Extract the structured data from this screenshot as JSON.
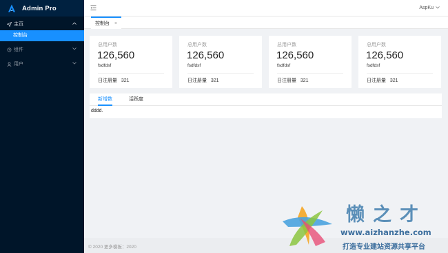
{
  "app": {
    "title": "Admin Pro"
  },
  "sidebar": {
    "groups": [
      {
        "label": "主页",
        "icon": "send-icon",
        "expanded": true,
        "items": [
          {
            "label": "控制台",
            "active": true
          }
        ]
      },
      {
        "label": "组件",
        "icon": "settings-icon",
        "expanded": false
      },
      {
        "label": "用户",
        "icon": "user-icon",
        "expanded": false
      }
    ]
  },
  "header": {
    "user": "AspKu"
  },
  "tabs": [
    {
      "label": "控制台",
      "close": "×"
    }
  ],
  "cards": [
    {
      "title": "总用户数",
      "value": "126,560",
      "sub": "fsdfdsf",
      "foot": "日注册量   321"
    },
    {
      "title": "总用户数",
      "value": "126,560",
      "sub": "fsdfdsf",
      "foot": "日注册量   321"
    },
    {
      "title": "总用户数",
      "value": "126,560",
      "sub": "fsdfdsf",
      "foot": "日注册量   321"
    },
    {
      "title": "总用户数",
      "value": "126,560",
      "sub": "fsdfdsf",
      "foot": "日注册量   321"
    }
  ],
  "panel": {
    "tabs": [
      {
        "label": "新增数",
        "active": true
      },
      {
        "label": "活跃度",
        "active": false
      }
    ],
    "content": "dddd."
  },
  "footer": {
    "text": "© 2020 更多模板：2020"
  },
  "watermark": {
    "brand": "懒之才",
    "url": "www.aizhanzhe.com",
    "slogan": "打造专业建站资源共享平台"
  },
  "colors": {
    "sidebar": "#001529",
    "accent": "#1890ff",
    "background": "#f0f2f5"
  }
}
